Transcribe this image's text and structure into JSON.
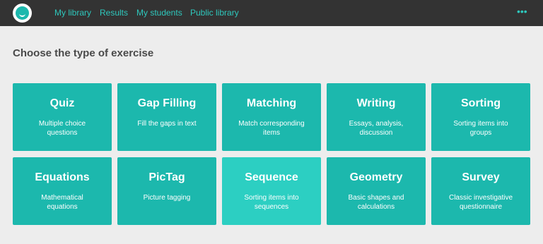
{
  "nav": {
    "items": [
      "My library",
      "Results",
      "My students",
      "Public library"
    ],
    "more_icon": "more-dots-icon",
    "more_glyph": "•••"
  },
  "logo_icon": "app-logo-icon",
  "page": {
    "heading": "Choose the type of exercise"
  },
  "colors": {
    "topbar": "#333333",
    "accent": "#2ec8bd",
    "card": "#1cb8ad",
    "card_hover": "#2ccfc2"
  },
  "exercise_types": [
    {
      "title": "Quiz",
      "desc": "Multiple choice questions"
    },
    {
      "title": "Gap Filling",
      "desc": "Fill the gaps in text"
    },
    {
      "title": "Matching",
      "desc": "Match corresponding items"
    },
    {
      "title": "Writing",
      "desc": "Essays, analysis, discussion"
    },
    {
      "title": "Sorting",
      "desc": "Sorting items into groups"
    },
    {
      "title": "Equations",
      "desc": "Mathematical equations"
    },
    {
      "title": "PicTag",
      "desc": "Picture tagging"
    },
    {
      "title": "Sequence",
      "desc": "Sorting items into sequences"
    },
    {
      "title": "Geometry",
      "desc": "Basic shapes and calculations"
    },
    {
      "title": "Survey",
      "desc": "Classic investigative questionnaire"
    }
  ]
}
